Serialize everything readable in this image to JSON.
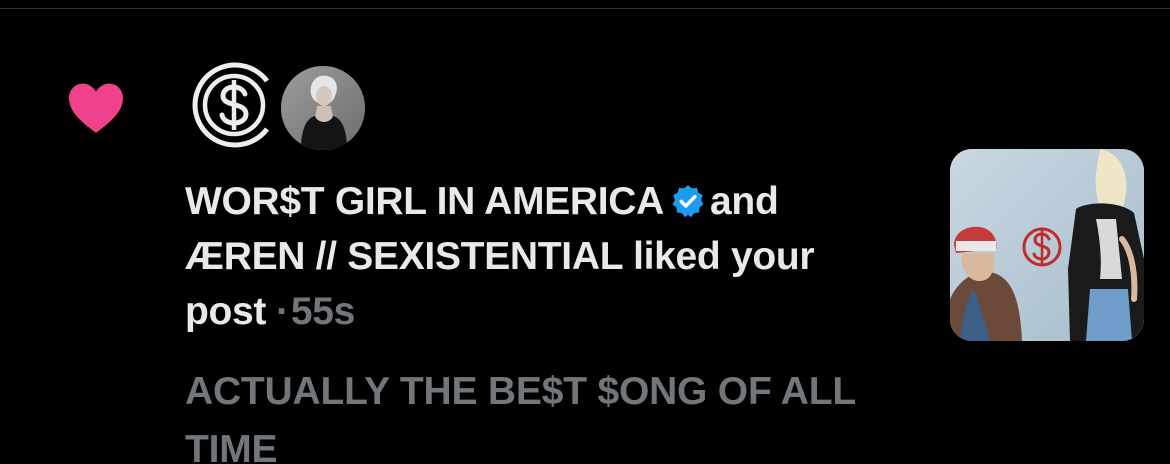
{
  "notification": {
    "type_icon": "heart-icon",
    "heart_color": "#f91880",
    "avatars": [
      {
        "name": "WOR$T GIRL IN AMERICA",
        "icon": "dollar-circle-logo"
      },
      {
        "name": "ÆREN // SEXISTENTIAL",
        "icon": "portrait-photo"
      }
    ],
    "user1": "WOR$T GIRL IN AMERICA",
    "verified_color": "#1d9bf0",
    "connector": "and",
    "user2": "ÆREN // SEXISTENTIAL",
    "action": "liked",
    "object": "your post",
    "separator": "·",
    "timestamp": "55s",
    "post_preview": "ACTUALLY THE BE$T $ONG OF ALL TIME",
    "thumbnail": "post-media-thumbnail"
  },
  "colors": {
    "background": "#000000",
    "primary_text": "#e7e9ea",
    "secondary_text": "#71767b",
    "divider": "#2f3336"
  }
}
